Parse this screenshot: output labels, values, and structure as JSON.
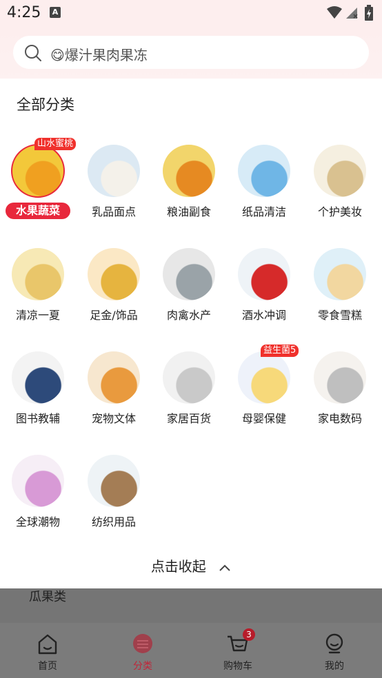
{
  "status_bar": {
    "time": "4:25",
    "a_badge": "A"
  },
  "search": {
    "placeholder": "😋爆汁果肉果冻"
  },
  "panel": {
    "title": "全部分类",
    "collapse_label": "点击收起"
  },
  "categories": [
    {
      "label": "水果蔬菜",
      "selected": true,
      "tag": "山水蜜桃",
      "colors": [
        "#f3c83a",
        "#f0a020"
      ]
    },
    {
      "label": "乳品面点",
      "selected": false,
      "colors": [
        "#dce9f3",
        "#f4f1ea"
      ]
    },
    {
      "label": "粮油副食",
      "selected": false,
      "colors": [
        "#f2d56b",
        "#e68a22"
      ]
    },
    {
      "label": "纸品清洁",
      "selected": false,
      "colors": [
        "#d7ebf7",
        "#6fb6e6"
      ]
    },
    {
      "label": "个护美妆",
      "selected": false,
      "colors": [
        "#f5efe0",
        "#d9c190"
      ]
    },
    {
      "label": "清凉一夏",
      "selected": false,
      "colors": [
        "#f7e9b5",
        "#e9c66a"
      ]
    },
    {
      "label": "足金/饰品",
      "selected": false,
      "colors": [
        "#fbe8c5",
        "#e6b43f"
      ]
    },
    {
      "label": "肉禽水产",
      "selected": false,
      "colors": [
        "#e7e7e7",
        "#9aa3a8"
      ]
    },
    {
      "label": "酒水冲调",
      "selected": false,
      "colors": [
        "#eef3f7",
        "#d62a2a"
      ]
    },
    {
      "label": "零食雪糕",
      "selected": false,
      "colors": [
        "#dff0f8",
        "#f2d7a0"
      ]
    },
    {
      "label": "图书教辅",
      "selected": false,
      "colors": [
        "#f3f3f3",
        "#2d4a7a"
      ]
    },
    {
      "label": "宠物文体",
      "selected": false,
      "colors": [
        "#f7e7cf",
        "#e99a3e"
      ]
    },
    {
      "label": "家居百货",
      "selected": false,
      "colors": [
        "#f1f1f1",
        "#c9c9c9"
      ]
    },
    {
      "label": "母婴保健",
      "selected": false,
      "tag": "益生菌5",
      "colors": [
        "#eef2fa",
        "#f7d97a"
      ]
    },
    {
      "label": "家电数码",
      "selected": false,
      "colors": [
        "#f5f2ee",
        "#bfbfbf"
      ]
    },
    {
      "label": "全球潮物",
      "selected": false,
      "colors": [
        "#f6eef6",
        "#d89ad6"
      ]
    },
    {
      "label": "纺织用品",
      "selected": false,
      "colors": [
        "#eef3f6",
        "#a47d55"
      ]
    }
  ],
  "behind": {
    "list_item": "瓜果类"
  },
  "tabbar": {
    "tabs": [
      {
        "label": "首页",
        "icon": "home-icon"
      },
      {
        "label": "分类",
        "icon": "category-icon",
        "active": true
      },
      {
        "label": "购物车",
        "icon": "cart-icon",
        "badge": "3"
      },
      {
        "label": "我的",
        "icon": "profile-icon"
      }
    ]
  }
}
